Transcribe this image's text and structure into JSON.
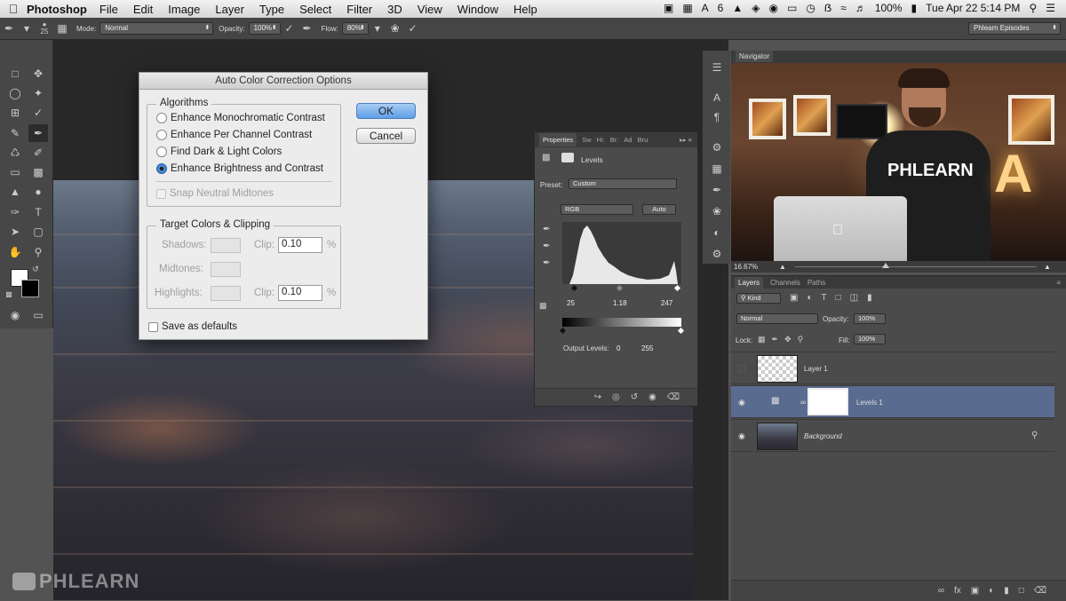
{
  "menubar": {
    "app": "Photoshop",
    "items": [
      "File",
      "Edit",
      "Image",
      "Layer",
      "Type",
      "Select",
      "Filter",
      "3D",
      "View",
      "Window",
      "Help"
    ],
    "status": {
      "adobe_count": "6",
      "battery": "100%",
      "datetime": "Tue Apr 22  5:14 PM"
    }
  },
  "options_bar": {
    "brush_size": "25",
    "mode_label": "Mode:",
    "mode_value": "Normal",
    "opacity_label": "Opacity:",
    "opacity_value": "100%",
    "flow_label": "Flow:",
    "flow_value": "80%",
    "workspace": "Phlearn Episodes"
  },
  "dialog": {
    "title": "Auto Color Correction Options",
    "algorithms_title": "Algorithms",
    "options": [
      "Enhance Monochromatic Contrast",
      "Enhance Per Channel Contrast",
      "Find Dark & Light Colors",
      "Enhance Brightness and Contrast"
    ],
    "selected_index": 3,
    "snap_label": "Snap Neutral Midtones",
    "target_title": "Target Colors & Clipping",
    "shadows_label": "Shadows:",
    "midtones_label": "Midtones:",
    "highlights_label": "Highlights:",
    "clip_label": "Clip:",
    "shadows_clip": "0.10",
    "highlights_clip": "0.10",
    "percent": "%",
    "save_defaults": "Save as defaults",
    "ok_label": "OK",
    "cancel_label": "Cancel"
  },
  "properties": {
    "tabs": [
      "Properties",
      "Sw",
      "Hi:",
      "Br:",
      "Ad",
      "Bru"
    ],
    "panel_title": "Levels",
    "preset_label": "Preset:",
    "preset_value": "Custom",
    "channel": "RGB",
    "auto_label": "Auto",
    "input_black": "25",
    "input_gamma": "1.18",
    "input_white": "247",
    "output_label": "Output Levels:",
    "output_black": "0",
    "output_white": "255"
  },
  "navigator": {
    "title": "Navigator",
    "zoom": "16.67%"
  },
  "layers": {
    "tabs": [
      "Layers",
      "Channels",
      "Paths"
    ],
    "kind_label": "Kind",
    "blend_mode": "Normal",
    "opacity_label": "Opacity:",
    "opacity_value": "100%",
    "lock_label": "Lock:",
    "fill_label": "Fill:",
    "fill_value": "100%",
    "rows": [
      {
        "name": "Layer 1"
      },
      {
        "name": "Levels 1"
      },
      {
        "name": "Background"
      }
    ]
  },
  "watermark": "PHLEARN",
  "colors": {
    "accent_selection": "#596b8e",
    "ok_button": "#5e9de6"
  }
}
